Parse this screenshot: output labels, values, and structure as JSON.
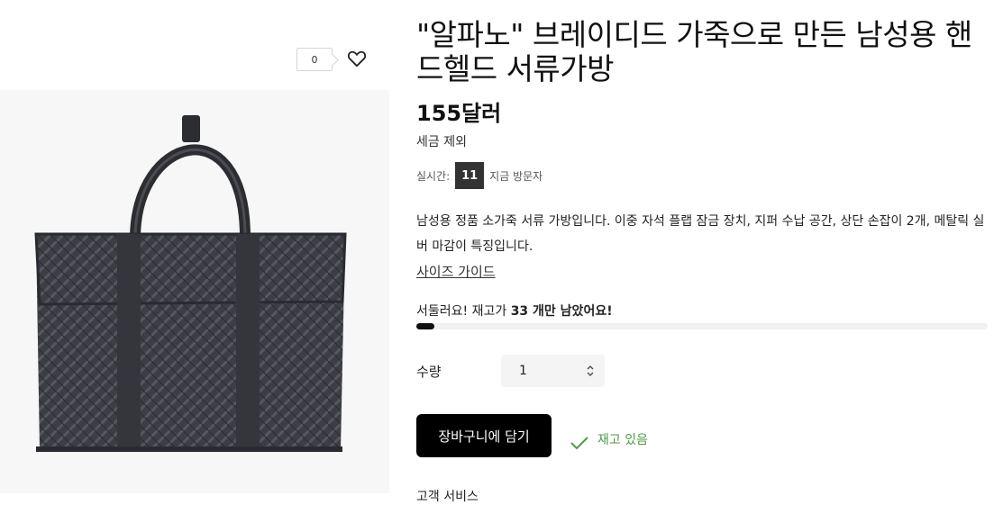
{
  "wishlist": {
    "count": "0",
    "icon": "heart-icon"
  },
  "product": {
    "title": "\"알파노\" 브레이디드 가죽으로 만든 남성용 핸드헬드 서류가방",
    "price": "155달러",
    "tax_note": "세금 제외",
    "live_label": "실시간:",
    "live_count": "11",
    "live_suffix": "지금 방문자",
    "description": "남성용 정품 소가죽 서류 가방입니다. 이중 자석 플랩 잠금 장치, 지퍼 수납 공간, 상단 손잡이 2개, 메탈릭 실버 마감이 특징입니다.",
    "size_guide": "사이즈 가이드",
    "stock": {
      "prefix": "서둘러요! 재고가",
      "count_text": "33 개만 남았어요!",
      "level": 0.03
    },
    "quantity": {
      "label": "수량",
      "value": "1"
    },
    "add_to_cart": "장바구니에 담기",
    "in_stock": "재고 있음",
    "customer_service": "고객 서비스"
  },
  "colors": {
    "in_stock_green": "#4a9b46",
    "button_black": "#000000"
  }
}
